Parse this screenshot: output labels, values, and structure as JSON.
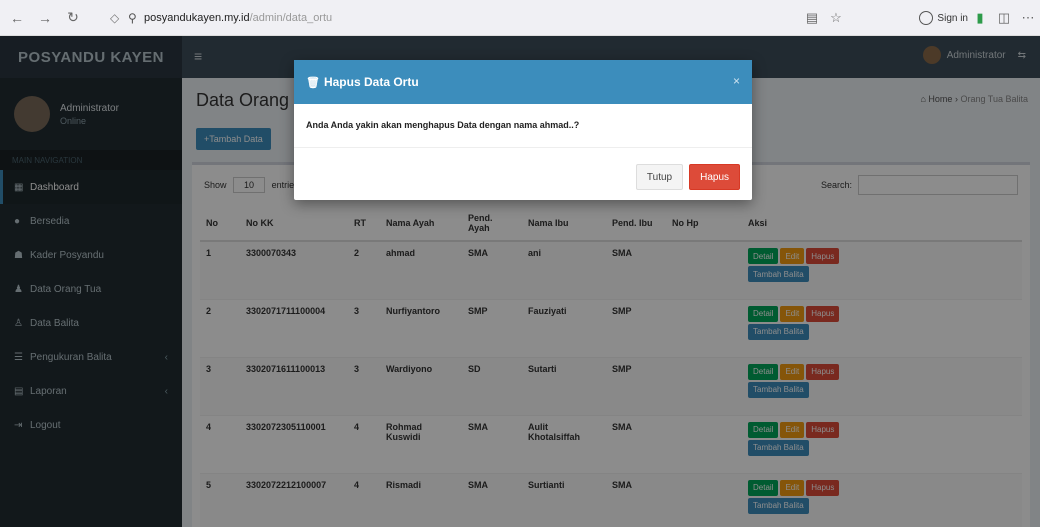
{
  "browser": {
    "url_host": "posyandukayen.my.id",
    "url_path": "/admin/data_ortu",
    "sign_in": "Sign in"
  },
  "app": {
    "logo": "POSYANDU KAYEN",
    "user_name": "Administrator",
    "sidebar_user": "Administrator",
    "sidebar_status": "Online",
    "sidebar_header": "MAIN NAVIGATION"
  },
  "sidebar": {
    "items": [
      {
        "label": "Dashboard",
        "icon": "dashboard-icon"
      },
      {
        "label": "Bersedia",
        "icon": "circle-icon"
      },
      {
        "label": "Kader Posyandu",
        "icon": "users-icon"
      },
      {
        "label": "Data Orang Tua",
        "icon": "user-icon"
      },
      {
        "label": "Data Balita",
        "icon": "child-icon"
      },
      {
        "label": "Pengukuran Balita",
        "icon": "list-icon"
      },
      {
        "label": "Laporan",
        "icon": "file-icon"
      },
      {
        "label": "Logout",
        "icon": "logout-icon"
      }
    ]
  },
  "content": {
    "title": "Data Orang Tua",
    "breadcrumb_home": "Home",
    "breadcrumb_current": "Orang Tua Balita",
    "add_button": "Tambah Data",
    "show_label": "Show",
    "show_value": "10",
    "entries_label": "entries",
    "search_label": "Search:"
  },
  "table": {
    "headers": [
      "No",
      "No KK",
      "RT",
      "Nama Ayah",
      "Pend. Ayah",
      "Nama Ibu",
      "Pend. Ibu",
      "No Hp",
      "Aksi"
    ],
    "rows": [
      {
        "no": "1",
        "kk": "3300070343",
        "rt": "2",
        "ayah": "ahmad",
        "pend_ayah": "SMA",
        "ibu": "ani",
        "pend_ibu": "SMA",
        "hp": ""
      },
      {
        "no": "2",
        "kk": "3302071711100004",
        "rt": "3",
        "ayah": "Nurfiyantoro",
        "pend_ayah": "SMP",
        "ibu": "Fauziyati",
        "pend_ibu": "SMP",
        "hp": ""
      },
      {
        "no": "3",
        "kk": "3302071611100013",
        "rt": "3",
        "ayah": "Wardiyono",
        "pend_ayah": "SD",
        "ibu": "Sutarti",
        "pend_ibu": "SMP",
        "hp": ""
      },
      {
        "no": "4",
        "kk": "3302072305110001",
        "rt": "4",
        "ayah": "Rohmad Kuswidi",
        "pend_ayah": "SMA",
        "ibu": "Aulit Khotalsiffah",
        "pend_ibu": "SMA",
        "hp": ""
      },
      {
        "no": "5",
        "kk": "3302072212100007",
        "rt": "4",
        "ayah": "Rismadi",
        "pend_ayah": "SMA",
        "ibu": "Surtianti",
        "pend_ibu": "SMA",
        "hp": ""
      }
    ],
    "action_labels": {
      "detail": "Detail",
      "edit": "Edit",
      "delete": "Hapus",
      "child": "Tambah Balita"
    }
  },
  "modal": {
    "title": "Hapus Data Ortu",
    "message": "Anda Anda yakin akan menghapus Data dengan nama ahmad..?",
    "close_icon": "×",
    "cancel_label": "Tutup",
    "confirm_label": "Hapus"
  },
  "colors": {
    "primary": "#3c8dbc",
    "danger": "#dd4b39",
    "success": "#00a65a",
    "warning": "#f39c12",
    "sidebar_bg": "#222d32"
  }
}
